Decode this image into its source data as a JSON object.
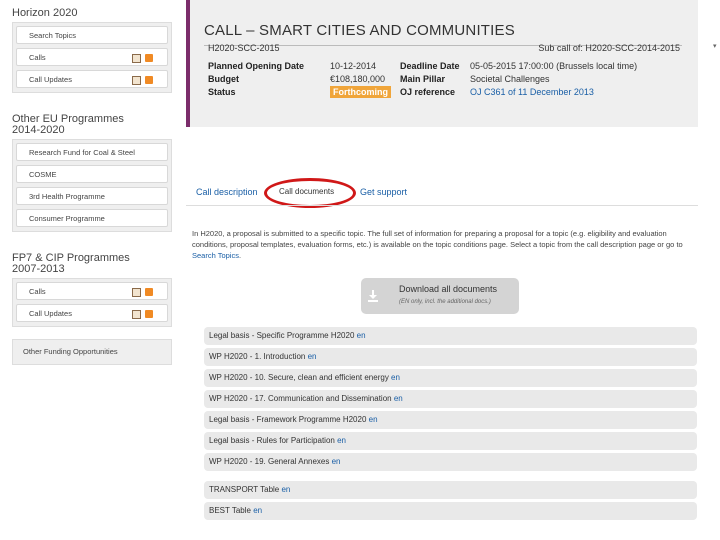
{
  "sidebar": {
    "sections": [
      {
        "title_lines": [
          "Horizon 2020"
        ],
        "items": [
          {
            "label": "Search Topics",
            "icons": false
          },
          {
            "label": "Calls",
            "icons": true
          },
          {
            "label": "Call Updates",
            "icons": true
          }
        ]
      },
      {
        "title_lines": [
          "Other EU Programmes",
          "2014-2020"
        ],
        "items": [
          {
            "label": "Research Fund for Coal & Steel",
            "icons": false
          },
          {
            "label": "COSME",
            "icons": false
          },
          {
            "label": "3rd Health Programme",
            "icons": false
          },
          {
            "label": "Consumer Programme",
            "icons": false
          }
        ]
      },
      {
        "title_lines": [
          "FP7 & CIP Programmes",
          "2007-2013"
        ],
        "items": [
          {
            "label": "Calls",
            "icons": true
          },
          {
            "label": "Call Updates",
            "icons": true
          }
        ]
      }
    ],
    "other": "Other Funding Opportunities"
  },
  "header": {
    "title": "CALL – SMART CITIES AND COMMUNITIES",
    "topic_id": "H2020-SCC-2015",
    "sub_call": "Sub call of: H2020-SCC-2014-2015",
    "col1": [
      {
        "label": "Planned Opening Date",
        "value": "10-12-2014"
      },
      {
        "label": "Budget",
        "value": "€108,180,000"
      },
      {
        "label": "Status",
        "value": "Forthcoming"
      }
    ],
    "col2": [
      {
        "label": "Deadline Date",
        "value": "05-05-2015 17:00:00 (Brussels local time)"
      },
      {
        "label": "Main Pillar",
        "value": "Societal Challenges"
      },
      {
        "label": "OJ reference",
        "value": "OJ C361 of 11 December 2013"
      }
    ],
    "status_color": "#f0a53a"
  },
  "tabs": [
    "Call description",
    "Call documents",
    "Get support"
  ],
  "intro": {
    "text": "In H2020, a proposal is submitted to a specific topic. The full set of information for preparing a proposal for a topic (e.g. eligibility and evaluation conditions, proposal templates, evaluation forms, etc.) is available on the topic conditions page. Select a topic from the call description page or go to",
    "link": "Search Topics",
    "end": "."
  },
  "download": {
    "title": "Download all documents",
    "subtitle": "(EN only, incl. the additional docs.)"
  },
  "documents": [
    {
      "text": "Legal basis - Specific Programme H2020",
      "lang": "en"
    },
    {
      "text": "WP H2020 - 1. Introduction",
      "lang": "en"
    },
    {
      "text": "WP H2020 - 10. Secure, clean and efficient energy",
      "lang": "en"
    },
    {
      "text": "WP H2020 - 17. Communication and Dissemination",
      "lang": "en"
    },
    {
      "text": "Legal basis - Framework Programme H2020",
      "lang": "en"
    },
    {
      "text": "Legal basis - Rules for Participation",
      "lang": "en"
    },
    {
      "text": "WP H2020 - 19. General Annexes",
      "lang": "en"
    }
  ],
  "tables": [
    {
      "text": "TRANSPORT Table",
      "lang": "en"
    },
    {
      "text": "BEST Table",
      "lang": "en"
    }
  ],
  "colors": {
    "accent_bar": "#7b2d6b",
    "link": "#1a5fa6",
    "highlight_oval": "#d01818"
  }
}
